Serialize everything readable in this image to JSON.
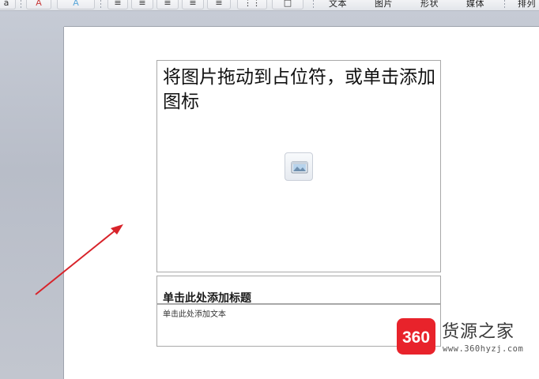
{
  "ribbon": {
    "tabs": [
      {
        "label": "文本"
      },
      {
        "label": "图片"
      },
      {
        "label": "形状"
      },
      {
        "label": "媒体"
      },
      {
        "label": "排列"
      }
    ],
    "font_color_label": "A",
    "font_size_label": "a"
  },
  "slide": {
    "picture_placeholder": {
      "prompt": "将图片拖动到占位符，或单击添加图标",
      "icon": "picture-insert-icon"
    },
    "title_placeholder": {
      "prompt": "单击此处添加标题"
    },
    "text_placeholder": {
      "prompt": "单击此处添加文本"
    }
  },
  "annotation": {
    "icon": "red-arrow-icon",
    "color": "#d8232a"
  },
  "watermark": {
    "badge_text": "360",
    "title": "货源之家",
    "url": "www.360hyzj.com",
    "badge_color": "#e8232b"
  }
}
